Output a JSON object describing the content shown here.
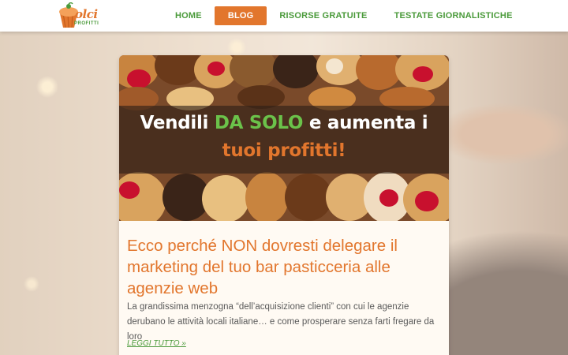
{
  "header": {
    "logo": {
      "text": "olci",
      "subtext": "PROFITTI",
      "accent_color": "#e2762d",
      "secondary_color": "#4a9a3a"
    },
    "nav": [
      {
        "label": "HOME",
        "active": false
      },
      {
        "label": "BLOG",
        "active": true
      },
      {
        "label": "RISORSE GRATUITE",
        "active": false
      },
      {
        "label": "TESTATE GIORNALISTICHE",
        "active": false
      }
    ]
  },
  "post": {
    "hero": {
      "line1_before": "Vendili ",
      "line1_highlight": "DA SOLO",
      "line1_after": " e aumenta i",
      "line2": "tuoi profitti!"
    },
    "title": "Ecco perché NON dovresti delegare il marketing del tuo bar pasticceria alle agenzie web",
    "excerpt": "La grandissima menzogna “dell’acquisizione clienti” con cui le agenzie derubano le attività locali italiane… e come prosperare senza farti fregare da loro",
    "read_more": "LEGGI TUTTO »"
  },
  "colors": {
    "brand_orange": "#e2762d",
    "brand_green": "#4a9a3a",
    "hero_green": "#6bc24a"
  }
}
